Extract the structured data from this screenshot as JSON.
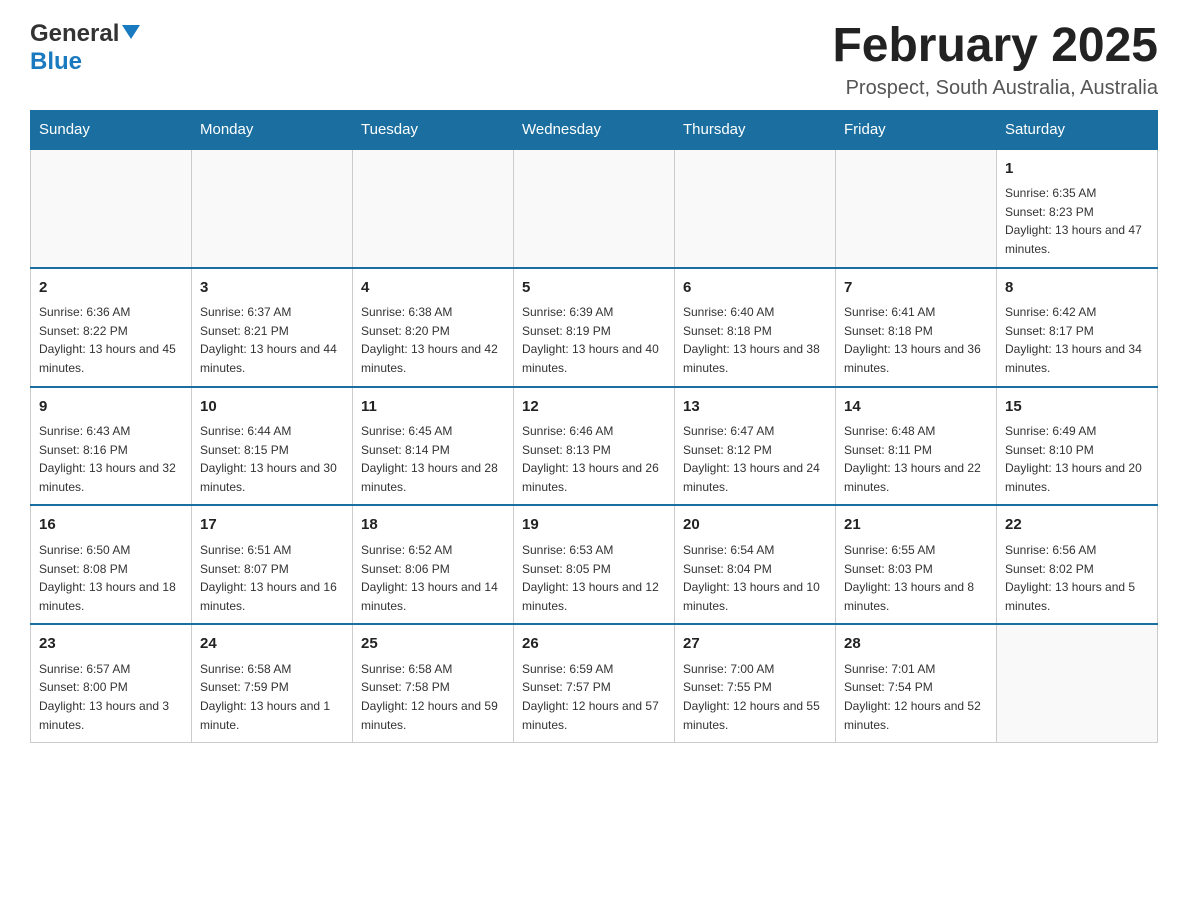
{
  "header": {
    "logo_general": "General",
    "logo_blue": "Blue",
    "title": "February 2025",
    "subtitle": "Prospect, South Australia, Australia"
  },
  "calendar": {
    "days_of_week": [
      "Sunday",
      "Monday",
      "Tuesday",
      "Wednesday",
      "Thursday",
      "Friday",
      "Saturday"
    ],
    "weeks": [
      [
        {
          "day": "",
          "info": ""
        },
        {
          "day": "",
          "info": ""
        },
        {
          "day": "",
          "info": ""
        },
        {
          "day": "",
          "info": ""
        },
        {
          "day": "",
          "info": ""
        },
        {
          "day": "",
          "info": ""
        },
        {
          "day": "1",
          "info": "Sunrise: 6:35 AM\nSunset: 8:23 PM\nDaylight: 13 hours and 47 minutes."
        }
      ],
      [
        {
          "day": "2",
          "info": "Sunrise: 6:36 AM\nSunset: 8:22 PM\nDaylight: 13 hours and 45 minutes."
        },
        {
          "day": "3",
          "info": "Sunrise: 6:37 AM\nSunset: 8:21 PM\nDaylight: 13 hours and 44 minutes."
        },
        {
          "day": "4",
          "info": "Sunrise: 6:38 AM\nSunset: 8:20 PM\nDaylight: 13 hours and 42 minutes."
        },
        {
          "day": "5",
          "info": "Sunrise: 6:39 AM\nSunset: 8:19 PM\nDaylight: 13 hours and 40 minutes."
        },
        {
          "day": "6",
          "info": "Sunrise: 6:40 AM\nSunset: 8:18 PM\nDaylight: 13 hours and 38 minutes."
        },
        {
          "day": "7",
          "info": "Sunrise: 6:41 AM\nSunset: 8:18 PM\nDaylight: 13 hours and 36 minutes."
        },
        {
          "day": "8",
          "info": "Sunrise: 6:42 AM\nSunset: 8:17 PM\nDaylight: 13 hours and 34 minutes."
        }
      ],
      [
        {
          "day": "9",
          "info": "Sunrise: 6:43 AM\nSunset: 8:16 PM\nDaylight: 13 hours and 32 minutes."
        },
        {
          "day": "10",
          "info": "Sunrise: 6:44 AM\nSunset: 8:15 PM\nDaylight: 13 hours and 30 minutes."
        },
        {
          "day": "11",
          "info": "Sunrise: 6:45 AM\nSunset: 8:14 PM\nDaylight: 13 hours and 28 minutes."
        },
        {
          "day": "12",
          "info": "Sunrise: 6:46 AM\nSunset: 8:13 PM\nDaylight: 13 hours and 26 minutes."
        },
        {
          "day": "13",
          "info": "Sunrise: 6:47 AM\nSunset: 8:12 PM\nDaylight: 13 hours and 24 minutes."
        },
        {
          "day": "14",
          "info": "Sunrise: 6:48 AM\nSunset: 8:11 PM\nDaylight: 13 hours and 22 minutes."
        },
        {
          "day": "15",
          "info": "Sunrise: 6:49 AM\nSunset: 8:10 PM\nDaylight: 13 hours and 20 minutes."
        }
      ],
      [
        {
          "day": "16",
          "info": "Sunrise: 6:50 AM\nSunset: 8:08 PM\nDaylight: 13 hours and 18 minutes."
        },
        {
          "day": "17",
          "info": "Sunrise: 6:51 AM\nSunset: 8:07 PM\nDaylight: 13 hours and 16 minutes."
        },
        {
          "day": "18",
          "info": "Sunrise: 6:52 AM\nSunset: 8:06 PM\nDaylight: 13 hours and 14 minutes."
        },
        {
          "day": "19",
          "info": "Sunrise: 6:53 AM\nSunset: 8:05 PM\nDaylight: 13 hours and 12 minutes."
        },
        {
          "day": "20",
          "info": "Sunrise: 6:54 AM\nSunset: 8:04 PM\nDaylight: 13 hours and 10 minutes."
        },
        {
          "day": "21",
          "info": "Sunrise: 6:55 AM\nSunset: 8:03 PM\nDaylight: 13 hours and 8 minutes."
        },
        {
          "day": "22",
          "info": "Sunrise: 6:56 AM\nSunset: 8:02 PM\nDaylight: 13 hours and 5 minutes."
        }
      ],
      [
        {
          "day": "23",
          "info": "Sunrise: 6:57 AM\nSunset: 8:00 PM\nDaylight: 13 hours and 3 minutes."
        },
        {
          "day": "24",
          "info": "Sunrise: 6:58 AM\nSunset: 7:59 PM\nDaylight: 13 hours and 1 minute."
        },
        {
          "day": "25",
          "info": "Sunrise: 6:58 AM\nSunset: 7:58 PM\nDaylight: 12 hours and 59 minutes."
        },
        {
          "day": "26",
          "info": "Sunrise: 6:59 AM\nSunset: 7:57 PM\nDaylight: 12 hours and 57 minutes."
        },
        {
          "day": "27",
          "info": "Sunrise: 7:00 AM\nSunset: 7:55 PM\nDaylight: 12 hours and 55 minutes."
        },
        {
          "day": "28",
          "info": "Sunrise: 7:01 AM\nSunset: 7:54 PM\nDaylight: 12 hours and 52 minutes."
        },
        {
          "day": "",
          "info": ""
        }
      ]
    ]
  }
}
